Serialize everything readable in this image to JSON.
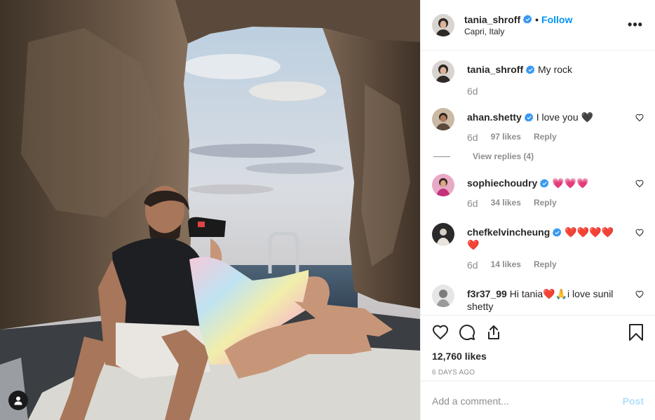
{
  "post": {
    "author": "tania_shroff",
    "follow_label": "Follow",
    "separator": "•",
    "location": "Capri, Italy",
    "more_label": "•••",
    "image_alt_icon": "user-tag-icon"
  },
  "comments": [
    {
      "username": "tania_shroff",
      "verified": true,
      "text": "My rock",
      "time": "6d",
      "likes": "",
      "reply": ""
    },
    {
      "username": "ahan.shetty",
      "verified": true,
      "text": "I love you 🖤",
      "time": "6d",
      "likes": "97 likes",
      "reply": "Reply",
      "view_replies": "View replies (4)"
    },
    {
      "username": "sophiechoudry",
      "verified": true,
      "text": "💗💗💗",
      "time": "6d",
      "likes": "34 likes",
      "reply": "Reply"
    },
    {
      "username": "chefkelvincheung",
      "verified": true,
      "text": "❤️❤️❤️❤️ ❤️",
      "time": "6d",
      "likes": "14 likes",
      "reply": "Reply"
    },
    {
      "username": "f3r37_99",
      "verified": false,
      "text": "Hi tania❤️🙏i love sunil shetty"
    }
  ],
  "actions": {
    "likes_count": "12,760 likes",
    "date": "6 DAYS AGO"
  },
  "add_comment": {
    "placeholder": "Add a comment...",
    "post_label": "Post"
  },
  "colors": {
    "accent": "#0095f6",
    "post_disabled": "#b2dffc",
    "secondary_text": "#8e8e8e",
    "verified": "#3897f0"
  }
}
